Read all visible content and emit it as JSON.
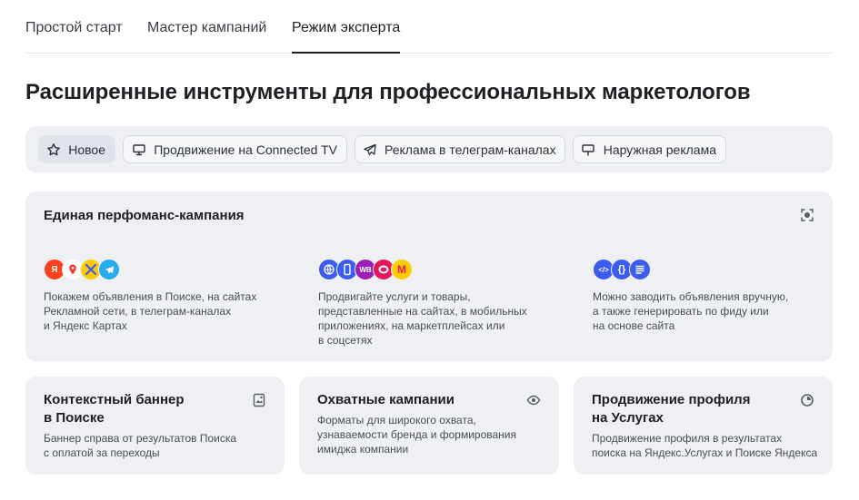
{
  "tabs": [
    {
      "label": "Простой старт"
    },
    {
      "label": "Мастер кампаний"
    },
    {
      "label": "Режим эксперта",
      "active": true
    }
  ],
  "page_title": "Расширенные инструменты для профессиональных маркетологов",
  "chips": [
    {
      "label": "Новое",
      "icon": "star-icon"
    },
    {
      "label": "Продвижение на Connected TV",
      "icon": "monitor-icon"
    },
    {
      "label": "Реклама в телеграм-каналах",
      "icon": "paper-plane-icon"
    },
    {
      "label": "Наружная реклама",
      "icon": "billboard-icon"
    }
  ],
  "performance_card": {
    "title": "Единая перфоманс-кампания",
    "features": [
      {
        "text": "Покажем объявления в Поиске, на сайтах\nРекламной сети, в телеграм-каналах\nи Яндекс Картах",
        "icons": [
          {
            "name": "yandex-icon",
            "text": "Я",
            "color": "#fc3f1d"
          },
          {
            "name": "maps-pin-icon",
            "text": "",
            "color": "#ff3333"
          },
          {
            "name": "rsya-icon",
            "text": "",
            "color": "#ffcc00"
          },
          {
            "name": "telegram-icon",
            "text": "",
            "color": "#2aabee"
          }
        ]
      },
      {
        "text": "Продвигайте услуги и товары,\nпредставленные на сайтах, в мобильных\nприложениях, на маркетплейсах или\nв соцсетях",
        "icons": [
          {
            "name": "globe-icon",
            "text": "",
            "color": "#3c5cf0"
          },
          {
            "name": "smartphone-icon",
            "text": "",
            "color": "#3c5cf0"
          },
          {
            "name": "wildberries-icon",
            "text": "WB",
            "color": "#9c1fb5"
          },
          {
            "name": "ozon-icon",
            "text": "",
            "color": "#e5165c"
          },
          {
            "name": "market-icon",
            "text": "M",
            "color": "#ffcc00"
          }
        ]
      },
      {
        "text": "Можно заводить объявления вручную,\nа также генерировать по фиду или\nна основе сайта",
        "icons": [
          {
            "name": "code-icon",
            "text": "</>",
            "color": "#3c5cf0"
          },
          {
            "name": "braces-icon",
            "text": "{}",
            "color": "#3c5cf0"
          },
          {
            "name": "document-icon",
            "text": "",
            "color": "#3c5cf0"
          }
        ]
      }
    ]
  },
  "cards": [
    {
      "title": "Контекстный баннер\nв Поиске",
      "desc": "Баннер справа от результатов Поиска\nс оплатой за переходы",
      "icon": "image-icon"
    },
    {
      "title": "Охватные кампании",
      "desc": "Форматы для широкого охвата,\nузнаваемости бренда и формирования\nимиджа компании",
      "icon": "eye-icon"
    },
    {
      "title": "Продвижение профиля\nна Услугах",
      "desc": "Продвижение профиля в результатах\nпоиска на Яндекс.Услугах и Поиске Яндекса",
      "icon": "services-icon"
    }
  ]
}
